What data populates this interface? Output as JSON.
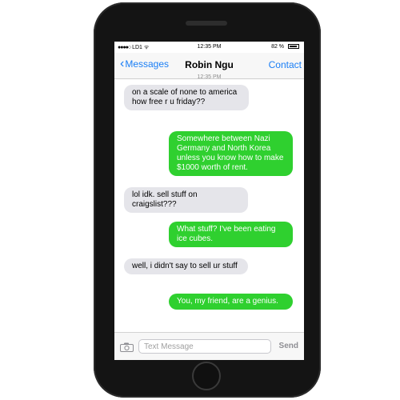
{
  "status_bar": {
    "carrier": "LD1",
    "time": "12:35 PM",
    "battery": "82 %"
  },
  "nav": {
    "back_label": "Messages",
    "title": "Robin Ngu",
    "contact_label": "Contact"
  },
  "thread": {
    "timestamp": "12:35 PM",
    "messages": [
      {
        "from": "them",
        "text": "on a scale of none to america how free r u friday??"
      },
      {
        "from": "me",
        "text": "Somewhere between Nazi Germany and North Korea unless you know how to make $1000 worth of rent."
      },
      {
        "from": "them",
        "text": "lol idk. sell stuff on craigslist???"
      },
      {
        "from": "me",
        "text": "What stuff? I've been eating ice cubes."
      },
      {
        "from": "them",
        "text": "well, i didn't say to sell ur stuff"
      },
      {
        "from": "me",
        "text": "You, my friend, are a genius."
      }
    ]
  },
  "input": {
    "placeholder": "Text Message",
    "value": "",
    "send_label": "Send"
  },
  "colors": {
    "sent_bubble": "#2fd02f",
    "received_bubble": "#e5e5ea",
    "accent": "#1a7ef5"
  }
}
